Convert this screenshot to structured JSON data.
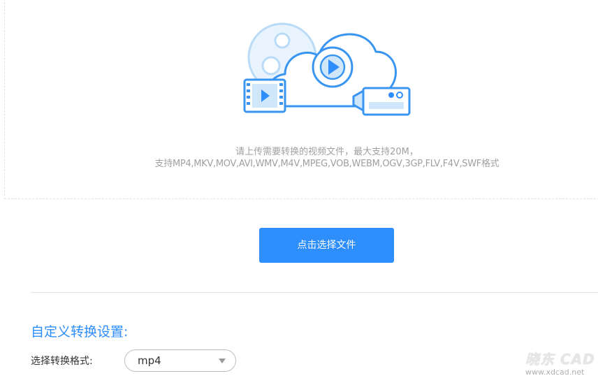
{
  "upload": {
    "hint_line1": "请上传需要转换的视频文件，最大支持20M，",
    "hint_line2": "支持MP4,MKV,MOV,AVI,WMV,M4V,MPEG,VOB,WEBM,OGV,3GP,FLV,F4V,SWF格式",
    "button_label": "点击选择文件",
    "illustration_icon": "cloud-video-upload-icon"
  },
  "settings": {
    "title": "自定义转换设置:",
    "format_label": "选择转换格式:",
    "format_value": "mp4"
  },
  "watermark": {
    "logo": "晓东 CAD",
    "url": "www.xdcad.net"
  },
  "colors": {
    "accent": "#2e8efc",
    "hint_text": "#a0a0a0",
    "label_text": "#333333"
  }
}
